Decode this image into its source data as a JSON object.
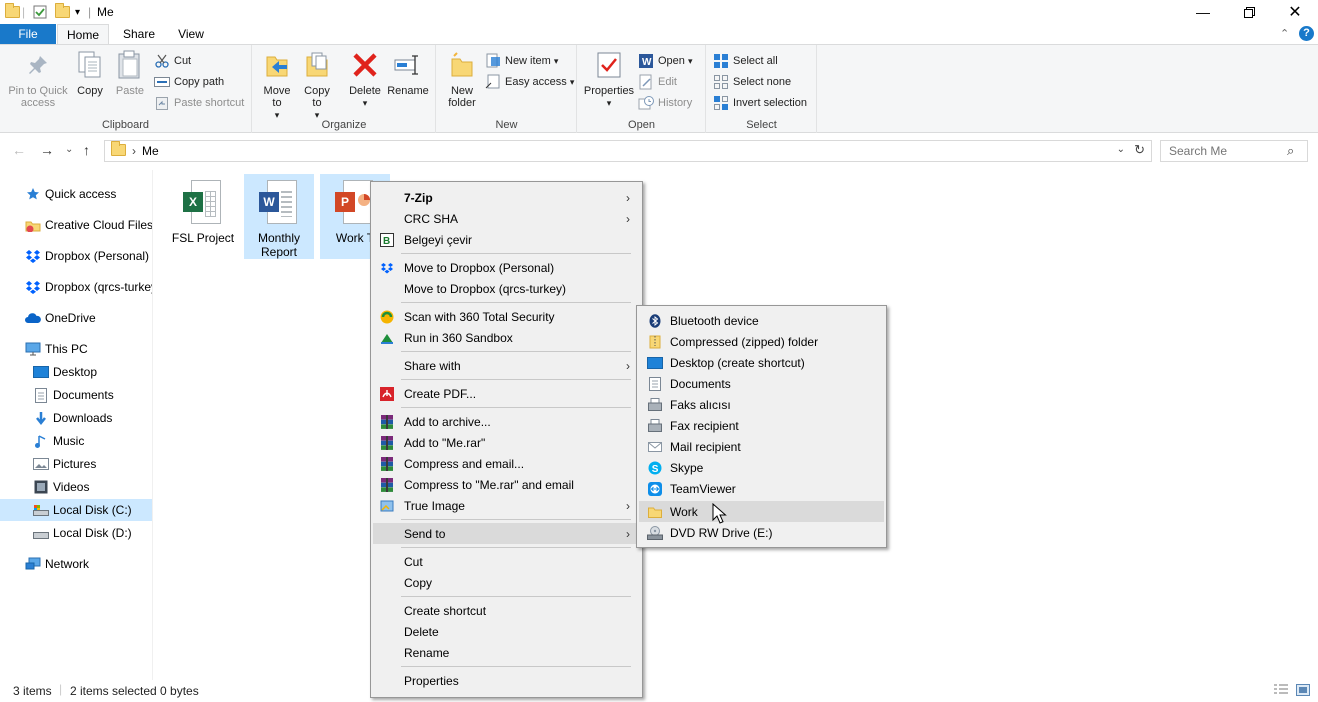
{
  "window": {
    "title": "Me"
  },
  "ribbon_tabs": [
    "File",
    "Home",
    "Share",
    "View"
  ],
  "clipboard": {
    "label": "Clipboard",
    "pin": "Pin to Quick access",
    "copy": "Copy",
    "paste": "Paste",
    "cut": "Cut",
    "copy_path": "Copy path",
    "paste_shortcut": "Paste shortcut"
  },
  "organize": {
    "label": "Organize",
    "move_to": "Move to",
    "copy_to": "Copy to",
    "delete": "Delete",
    "rename": "Rename"
  },
  "new": {
    "label": "New",
    "new_folder": "New folder",
    "new_item": "New item",
    "easy_access": "Easy access"
  },
  "open": {
    "label": "Open",
    "properties": "Properties",
    "open": "Open",
    "edit": "Edit",
    "history": "History"
  },
  "select": {
    "label": "Select",
    "select_all": "Select all",
    "select_none": "Select none",
    "invert": "Invert selection"
  },
  "address": {
    "path": "Me",
    "search_placeholder": "Search Me"
  },
  "sidebar": [
    {
      "label": "Quick access",
      "icon": "star-icon"
    },
    {
      "label": "Creative Cloud Files",
      "icon": "creative-cloud-icon"
    },
    {
      "label": "Dropbox (Personal)",
      "icon": "dropbox-icon"
    },
    {
      "label": "Dropbox (qrcs-turkey",
      "icon": "dropbox-icon"
    },
    {
      "label": "OneDrive",
      "icon": "onedrive-icon"
    },
    {
      "label": "This PC",
      "icon": "pc-icon"
    },
    {
      "label": "Desktop",
      "icon": "desktop-icon"
    },
    {
      "label": "Documents",
      "icon": "documents-icon"
    },
    {
      "label": "Downloads",
      "icon": "downloads-icon"
    },
    {
      "label": "Music",
      "icon": "music-icon"
    },
    {
      "label": "Pictures",
      "icon": "pictures-icon"
    },
    {
      "label": "Videos",
      "icon": "videos-icon"
    },
    {
      "label": "Local Disk (C:)",
      "icon": "drive-icon"
    },
    {
      "label": "Local Disk (D:)",
      "icon": "drive-icon"
    },
    {
      "label": "Network",
      "icon": "network-icon"
    }
  ],
  "files": [
    {
      "label": "FSL Project",
      "type": "excel",
      "badge": "X",
      "color": "#1e7145"
    },
    {
      "label": "Monthly Report",
      "type": "word",
      "badge": "W",
      "color": "#2b579a"
    },
    {
      "label": "Work T",
      "type": "powerpoint",
      "badge": "P",
      "color": "#d24726"
    }
  ],
  "context_menu": [
    {
      "label": "7-Zip",
      "bold": true,
      "submenu": true
    },
    {
      "label": "CRC SHA",
      "submenu": true
    },
    {
      "label": "Belgeyi çevir",
      "icon": "abbyy-icon"
    },
    {
      "label": "Move to Dropbox (Personal)",
      "icon": "dropbox-icon"
    },
    {
      "label": "Move to Dropbox (qrcs-turkey)"
    },
    {
      "label": "Scan with 360 Total Security",
      "icon": "security-360-icon"
    },
    {
      "label": "Run in 360 Sandbox",
      "icon": "sandbox-icon"
    },
    {
      "label": "Share with",
      "submenu": true
    },
    {
      "label": "Create PDF...",
      "icon": "pdf-icon"
    },
    {
      "label": "Add to archive...",
      "icon": "winrar-icon"
    },
    {
      "label": "Add to \"Me.rar\"",
      "icon": "winrar-icon"
    },
    {
      "label": "Compress and email...",
      "icon": "winrar-icon"
    },
    {
      "label": "Compress to \"Me.rar\" and email",
      "icon": "winrar-icon"
    },
    {
      "label": "True Image",
      "icon": "true-image-icon",
      "submenu": true
    },
    {
      "label": "Send to",
      "submenu": true,
      "active": true
    },
    {
      "label": "Cut"
    },
    {
      "label": "Copy"
    },
    {
      "label": "Create shortcut"
    },
    {
      "label": "Delete"
    },
    {
      "label": "Rename"
    },
    {
      "label": "Properties"
    }
  ],
  "send_to": [
    {
      "label": "Bluetooth device",
      "icon": "bluetooth-icon"
    },
    {
      "label": "Compressed (zipped) folder",
      "icon": "zip-folder-icon"
    },
    {
      "label": "Desktop (create shortcut)",
      "icon": "desktop-icon"
    },
    {
      "label": "Documents",
      "icon": "documents-icon"
    },
    {
      "label": "Faks alıcısı",
      "icon": "fax-icon"
    },
    {
      "label": "Fax recipient",
      "icon": "fax-icon"
    },
    {
      "label": "Mail recipient",
      "icon": "mail-icon"
    },
    {
      "label": "Skype",
      "icon": "skype-icon"
    },
    {
      "label": "TeamViewer",
      "icon": "teamviewer-icon"
    },
    {
      "label": "Work",
      "icon": "folder-icon",
      "active": true
    },
    {
      "label": "DVD RW Drive (E:)",
      "icon": "dvd-drive-icon"
    }
  ],
  "status": {
    "items": "3 items",
    "selected": "2 items selected 0 bytes"
  },
  "colors": {
    "accent": "#1979ca",
    "selection": "#cce8ff",
    "menu_bg": "#f0f0f0",
    "menu_hover": "#dadada"
  }
}
